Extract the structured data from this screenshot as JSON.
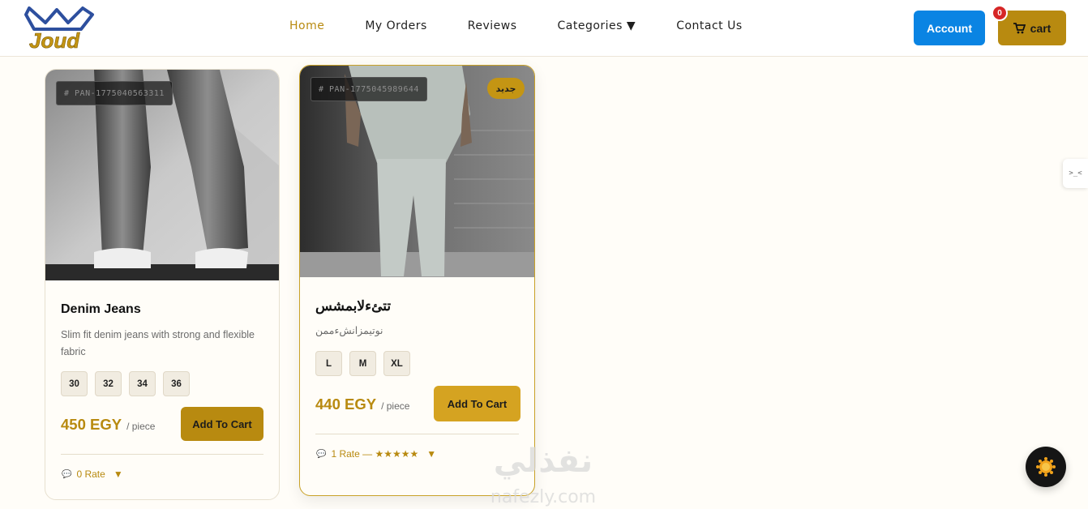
{
  "header": {
    "logo_text": "Joud",
    "nav": [
      {
        "label": "Home",
        "active": true
      },
      {
        "label": "My Orders",
        "active": false
      },
      {
        "label": "Reviews",
        "active": false
      },
      {
        "label": "Categories ▼",
        "active": false
      },
      {
        "label": "Contact Us",
        "active": false
      }
    ],
    "account_label": "Account",
    "cart_label": "cart",
    "cart_count": "0"
  },
  "products": [
    {
      "sku": "# PAN-1775040563311",
      "title": "Denim Jeans",
      "description": "Slim fit denim jeans with strong and flexible fabric",
      "sizes": [
        "30",
        "32",
        "34",
        "36"
      ],
      "price": "450 EGY",
      "unit": "/ piece",
      "add_label": "Add To Cart",
      "rating_text": "0 Rate",
      "rating_arrow": "▼"
    },
    {
      "sku": "# PAN-1775045989644",
      "badge": "جديد",
      "title": "تتئءلابمشس",
      "description": "نوتيمزانشءممن",
      "sizes": [
        "L",
        "M",
        "XL"
      ],
      "price": "440 EGY",
      "unit": "/ piece",
      "add_label": "Add To Cart",
      "rating_text": "1 Rate — ★★★★★",
      "rating_arrow": "▼"
    }
  ],
  "side_tab_label": ">_<",
  "watermark": {
    "arabic": "نفذلي",
    "latin": "nafezly.com"
  },
  "colors": {
    "accent": "#b88a10",
    "account_blue": "#0a84e3",
    "badge_red": "#d62626",
    "badge_gold": "#c49513"
  }
}
